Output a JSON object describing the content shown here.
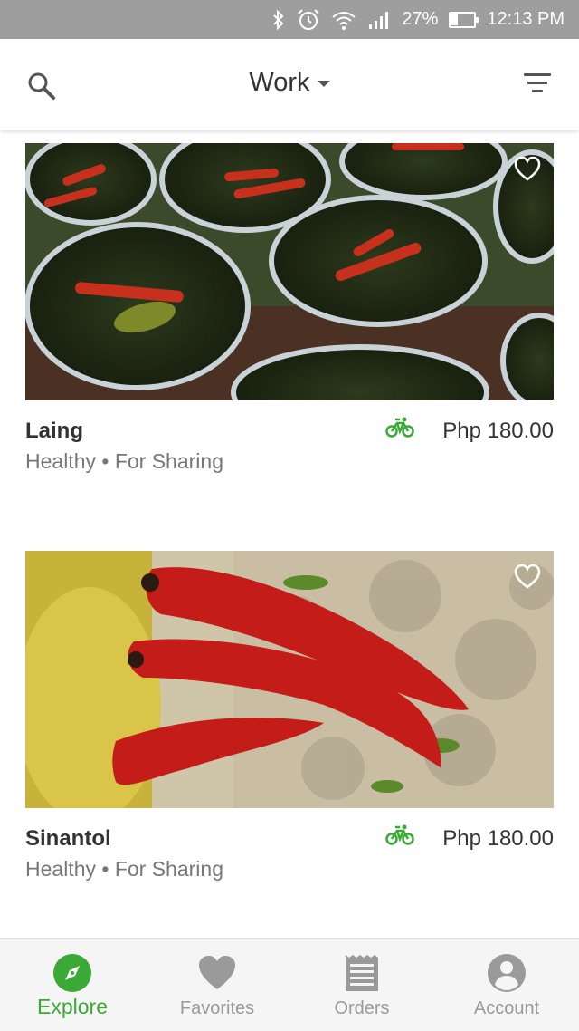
{
  "status_bar": {
    "battery": "27%",
    "battery_level": 0.27,
    "time": "12:13 PM",
    "icons": [
      "bluetooth-icon",
      "alarm-icon",
      "wifi-icon",
      "signal-icon",
      "battery-icon"
    ]
  },
  "header": {
    "location": "Work",
    "icons": [
      "search-icon",
      "chevron-down-icon",
      "filter-icon"
    ]
  },
  "items": [
    {
      "name": "Laing",
      "tags": "Healthy • For Sharing",
      "price": "Php 180.00",
      "delivery_icon": "bicycle-icon",
      "favorite_icon": "heart-outline-icon"
    },
    {
      "name": "Sinantol",
      "tags": "Healthy • For Sharing",
      "price": "Php 180.00",
      "delivery_icon": "bicycle-icon",
      "favorite_icon": "heart-outline-icon"
    }
  ],
  "bottom_nav": [
    {
      "label": "Explore",
      "icon": "compass-icon",
      "active": true
    },
    {
      "label": "Favorites",
      "icon": "heart-icon",
      "active": false
    },
    {
      "label": "Orders",
      "icon": "receipt-icon",
      "active": false
    },
    {
      "label": "Account",
      "icon": "person-icon",
      "active": false
    }
  ],
  "colors": {
    "accent": "#3aa935",
    "status_bar": "#9e9e9e",
    "inactive": "#9a9a9a"
  }
}
